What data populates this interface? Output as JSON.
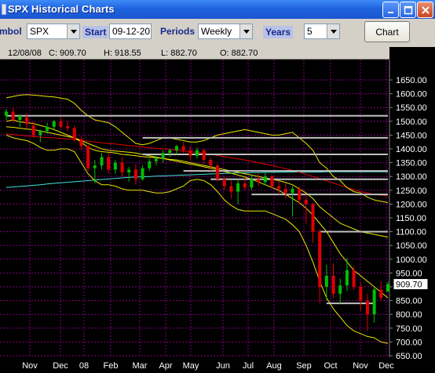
{
  "window": {
    "title": "SPX Historical Charts"
  },
  "toolbar": {
    "symbol_label": "mbol",
    "symbol_value": "SPX",
    "start_label": "Start",
    "start_value": "09-12-20",
    "periods_label": "Periods",
    "periods_value": "Weekly",
    "years_label": "Years",
    "years_value": "5",
    "chart_button": "Chart"
  },
  "info_bar": {
    "date": "12/08/08",
    "close": "C: 909.70",
    "high": "H: 918.55",
    "low": "L: 882.70",
    "open": "O: 882.70"
  },
  "colors": {
    "background": "#000000",
    "grid": "#800080",
    "up_candle": "#00c000",
    "down_candle": "#e00000",
    "bands": "#e8e800",
    "moving_average_red": "#e00000",
    "moving_average_cyan": "#40e0e0",
    "resistance_lines": "#c0c0c0"
  },
  "chart_data": {
    "type": "candlestick",
    "title": "",
    "x_ticks": [
      "Nov",
      "Dec",
      "08",
      "Feb",
      "Mar",
      "Apr",
      "May",
      "Jun",
      "Jul",
      "Aug",
      "Sep",
      "Oct",
      "Nov",
      "Dec"
    ],
    "y_ticks": [
      1650,
      1600,
      1550,
      1500,
      1450,
      1400,
      1350,
      1300,
      1250,
      1200,
      1150,
      1100,
      1050,
      1000,
      950,
      900,
      850,
      800,
      750,
      700,
      650
    ],
    "y_tick_labels": [
      "1650.00",
      "1600.00",
      "1550.00",
      "1500.00",
      "1450.00",
      "1400.00",
      "1350.00",
      "1300.00",
      "1250.00",
      "1200.00",
      "1150.00",
      "1100.00",
      "1050.00",
      "1000.00",
      "950.00",
      "900.00",
      "850.00",
      "800.00",
      "750.00",
      "700.00",
      "650.00"
    ],
    "ylim": [
      650,
      1665
    ],
    "last_price_label": "909.70",
    "last_price": 909.7,
    "candles": [
      {
        "o": 1520,
        "h": 1545,
        "l": 1505,
        "c": 1535
      },
      {
        "o": 1535,
        "h": 1550,
        "l": 1495,
        "c": 1505
      },
      {
        "o": 1505,
        "h": 1525,
        "l": 1480,
        "c": 1520
      },
      {
        "o": 1515,
        "h": 1530,
        "l": 1475,
        "c": 1490
      },
      {
        "o": 1485,
        "h": 1500,
        "l": 1440,
        "c": 1450
      },
      {
        "o": 1450,
        "h": 1470,
        "l": 1425,
        "c": 1465
      },
      {
        "o": 1465,
        "h": 1495,
        "l": 1455,
        "c": 1480
      },
      {
        "o": 1480,
        "h": 1505,
        "l": 1470,
        "c": 1500
      },
      {
        "o": 1500,
        "h": 1515,
        "l": 1475,
        "c": 1480
      },
      {
        "o": 1482,
        "h": 1500,
        "l": 1465,
        "c": 1475
      },
      {
        "o": 1475,
        "h": 1485,
        "l": 1425,
        "c": 1435
      },
      {
        "o": 1435,
        "h": 1445,
        "l": 1395,
        "c": 1410
      },
      {
        "o": 1410,
        "h": 1415,
        "l": 1320,
        "c": 1330
      },
      {
        "o": 1330,
        "h": 1360,
        "l": 1275,
        "c": 1340
      },
      {
        "o": 1340,
        "h": 1385,
        "l": 1325,
        "c": 1370
      },
      {
        "o": 1370,
        "h": 1385,
        "l": 1310,
        "c": 1325
      },
      {
        "o": 1325,
        "h": 1360,
        "l": 1310,
        "c": 1350
      },
      {
        "o": 1350,
        "h": 1370,
        "l": 1300,
        "c": 1315
      },
      {
        "o": 1315,
        "h": 1335,
        "l": 1280,
        "c": 1325
      },
      {
        "o": 1325,
        "h": 1345,
        "l": 1270,
        "c": 1290
      },
      {
        "o": 1290,
        "h": 1340,
        "l": 1285,
        "c": 1330
      },
      {
        "o": 1330,
        "h": 1365,
        "l": 1320,
        "c": 1355
      },
      {
        "o": 1355,
        "h": 1375,
        "l": 1340,
        "c": 1365
      },
      {
        "o": 1365,
        "h": 1395,
        "l": 1350,
        "c": 1385
      },
      {
        "o": 1385,
        "h": 1400,
        "l": 1370,
        "c": 1395
      },
      {
        "o": 1395,
        "h": 1415,
        "l": 1380,
        "c": 1410
      },
      {
        "o": 1410,
        "h": 1425,
        "l": 1385,
        "c": 1395
      },
      {
        "o": 1395,
        "h": 1410,
        "l": 1360,
        "c": 1375
      },
      {
        "o": 1375,
        "h": 1405,
        "l": 1365,
        "c": 1395
      },
      {
        "o": 1395,
        "h": 1400,
        "l": 1345,
        "c": 1360
      },
      {
        "o": 1360,
        "h": 1370,
        "l": 1320,
        "c": 1340
      },
      {
        "o": 1340,
        "h": 1345,
        "l": 1280,
        "c": 1290
      },
      {
        "o": 1290,
        "h": 1300,
        "l": 1250,
        "c": 1265
      },
      {
        "o": 1265,
        "h": 1285,
        "l": 1220,
        "c": 1245
      },
      {
        "o": 1245,
        "h": 1290,
        "l": 1200,
        "c": 1275
      },
      {
        "o": 1275,
        "h": 1295,
        "l": 1250,
        "c": 1260
      },
      {
        "o": 1260,
        "h": 1305,
        "l": 1250,
        "c": 1290
      },
      {
        "o": 1290,
        "h": 1310,
        "l": 1265,
        "c": 1280
      },
      {
        "o": 1280,
        "h": 1315,
        "l": 1270,
        "c": 1300
      },
      {
        "o": 1300,
        "h": 1305,
        "l": 1255,
        "c": 1265
      },
      {
        "o": 1265,
        "h": 1285,
        "l": 1235,
        "c": 1255
      },
      {
        "o": 1255,
        "h": 1275,
        "l": 1220,
        "c": 1240
      },
      {
        "o": 1240,
        "h": 1265,
        "l": 1155,
        "c": 1255
      },
      {
        "o": 1255,
        "h": 1265,
        "l": 1200,
        "c": 1215
      },
      {
        "o": 1215,
        "h": 1235,
        "l": 1130,
        "c": 1200
      },
      {
        "o": 1200,
        "h": 1205,
        "l": 1060,
        "c": 1100
      },
      {
        "o": 1100,
        "h": 1110,
        "l": 840,
        "c": 900
      },
      {
        "o": 900,
        "h": 980,
        "l": 850,
        "c": 940
      },
      {
        "o": 940,
        "h": 985,
        "l": 860,
        "c": 875
      },
      {
        "o": 875,
        "h": 930,
        "l": 840,
        "c": 905
      },
      {
        "o": 905,
        "h": 1005,
        "l": 885,
        "c": 960
      },
      {
        "o": 960,
        "h": 975,
        "l": 890,
        "c": 900
      },
      {
        "o": 900,
        "h": 915,
        "l": 815,
        "c": 850
      },
      {
        "o": 850,
        "h": 875,
        "l": 740,
        "c": 800
      },
      {
        "o": 800,
        "h": 900,
        "l": 770,
        "c": 890
      },
      {
        "o": 890,
        "h": 920,
        "l": 850,
        "c": 860
      },
      {
        "o": 882.7,
        "h": 918.55,
        "l": 882.7,
        "c": 909.7
      }
    ],
    "moving_average_red": [
      1455,
      1452,
      1450,
      1447,
      1445,
      1443,
      1441,
      1440,
      1438,
      1436,
      1434,
      1431,
      1428,
      1425,
      1422,
      1420,
      1418,
      1415,
      1412,
      1410,
      1407,
      1404,
      1402,
      1400,
      1398,
      1395,
      1392,
      1390,
      1387,
      1384,
      1380,
      1376,
      1372,
      1368,
      1364,
      1360,
      1355,
      1350,
      1345,
      1340,
      1334,
      1328,
      1322,
      1315,
      1308,
      1300,
      1292,
      1284,
      1276,
      1268,
      1260,
      1252,
      1245,
      1240,
      1235,
      1232,
      1230
    ],
    "moving_average_cyan": [
      1260,
      1262,
      1264,
      1266,
      1268,
      1270,
      1273,
      1275,
      1277,
      1279,
      1281,
      1283,
      1285,
      1287,
      1289,
      1291,
      1293,
      1295,
      1297,
      1298,
      1299,
      1300,
      1301,
      1302,
      1303,
      1304,
      1305,
      1306,
      1307,
      1308,
      1309,
      1310,
      1311,
      1312,
      1313,
      1313,
      1314,
      1314,
      1315,
      1315,
      1315,
      1316,
      1316,
      1316,
      1316,
      1316,
      1316,
      1317,
      1317,
      1317,
      1317,
      1317,
      1317,
      1317,
      1317,
      1317,
      1317
    ],
    "upper_band": [
      1585,
      1590,
      1595,
      1597,
      1595,
      1593,
      1590,
      1588,
      1584,
      1580,
      1565,
      1540,
      1520,
      1505,
      1500,
      1495,
      1480,
      1460,
      1440,
      1420,
      1415,
      1420,
      1430,
      1440,
      1440,
      1435,
      1430,
      1425,
      1425,
      1430,
      1440,
      1450,
      1455,
      1460,
      1465,
      1470,
      1465,
      1460,
      1455,
      1450,
      1450,
      1455,
      1460,
      1440,
      1420,
      1395,
      1350,
      1330,
      1300,
      1285,
      1260,
      1245,
      1240,
      1225,
      1215,
      1210,
      1205
    ],
    "lower_band": [
      1450,
      1440,
      1435,
      1430,
      1420,
      1405,
      1395,
      1395,
      1400,
      1400,
      1390,
      1350,
      1310,
      1285,
      1270,
      1270,
      1265,
      1255,
      1250,
      1250,
      1250,
      1245,
      1240,
      1240,
      1245,
      1255,
      1265,
      1285,
      1290,
      1285,
      1270,
      1245,
      1215,
      1195,
      1180,
      1175,
      1175,
      1175,
      1175,
      1165,
      1155,
      1145,
      1125,
      1100,
      1050,
      990,
      920,
      860,
      820,
      790,
      760,
      740,
      730,
      720,
      715,
      700,
      695
    ],
    "upper_band_2": [
      1500,
      1505,
      1498,
      1495,
      1492,
      1485,
      1478,
      1470,
      1460,
      1450,
      1440,
      1425,
      1405,
      1395,
      1390,
      1388,
      1385,
      1380,
      1378,
      1375,
      1372,
      1370,
      1368,
      1365,
      1362,
      1360,
      1355,
      1350,
      1345,
      1340,
      1335,
      1330,
      1325,
      1320,
      1315,
      1310,
      1305,
      1300,
      1295,
      1290,
      1285,
      1278,
      1270,
      1255,
      1240,
      1220,
      1190,
      1170,
      1150,
      1130,
      1120,
      1110,
      1100,
      1095,
      1090,
      1085,
      1080
    ],
    "lower_band_2": [
      1480,
      1478,
      1475,
      1472,
      1470,
      1465,
      1460,
      1455,
      1450,
      1445,
      1440,
      1430,
      1420,
      1410,
      1400,
      1395,
      1392,
      1390,
      1388,
      1385,
      1380,
      1375,
      1370,
      1365,
      1360,
      1355,
      1350,
      1345,
      1340,
      1335,
      1330,
      1325,
      1318,
      1312,
      1305,
      1298,
      1290,
      1280,
      1270,
      1260,
      1250,
      1235,
      1220,
      1205,
      1185,
      1160,
      1130,
      1100,
      1060,
      1020,
      990,
      960,
      940,
      920,
      900,
      880,
      860
    ],
    "horizontal_levels": [
      {
        "value": 1520,
        "start_index": 0,
        "end_index": 56
      },
      {
        "value": 1440,
        "start_index": 20,
        "end_index": 56
      },
      {
        "value": 1380,
        "start_index": 20,
        "end_index": 56
      },
      {
        "value": 1320,
        "start_index": 26,
        "end_index": 56
      },
      {
        "value": 1290,
        "start_index": 30,
        "end_index": 56
      },
      {
        "value": 1235,
        "start_index": 36,
        "end_index": 56
      },
      {
        "value": 1100,
        "start_index": 46,
        "end_index": 56
      },
      {
        "value": 840,
        "start_index": 47,
        "end_index": 54
      }
    ]
  }
}
